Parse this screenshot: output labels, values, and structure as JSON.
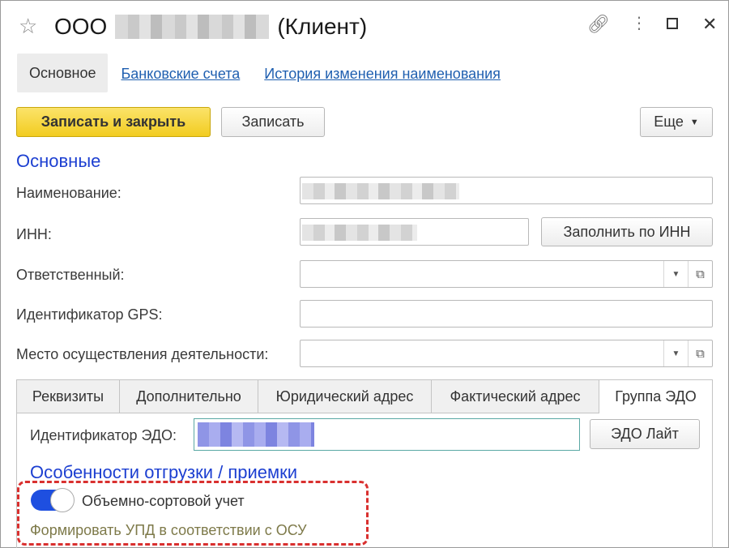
{
  "window": {
    "title_prefix": "ООО",
    "title_suffix": "(Клиент)"
  },
  "top_tabs": {
    "active": "Основное",
    "links": [
      "Банковские счета",
      "История изменения наименования"
    ]
  },
  "toolbar": {
    "save_close_label": "Записать и закрыть",
    "save_label": "Записать",
    "more_label": "Еще"
  },
  "section_main": {
    "title": "Основные",
    "name_label": "Наименование:",
    "inn_label": "ИНН:",
    "fill_inn_button": "Заполнить по ИНН",
    "responsible_label": "Ответственный:",
    "gps_label": "Идентификатор GPS:",
    "place_label": "Место осуществления деятельности:"
  },
  "bottom_tabs": [
    "Реквизиты",
    "Дополнительно",
    "Юридический адрес",
    "Фактический адрес",
    "Группа ЭДО"
  ],
  "edo": {
    "id_label": "Идентификатор ЭДО:",
    "lite_button": "ЭДО Лайт"
  },
  "shipping": {
    "title": "Особенности отгрузки / приемки",
    "toggle_label": "Объемно-сортовой учет",
    "toggle_on": true,
    "hint": "Формировать УПД в соответствии с ОСУ"
  },
  "colors": {
    "accent_yellow": "#f2cc20",
    "section_blue": "#1c3fd1",
    "link_blue": "#1f5fb0",
    "toggle_blue": "#1e4fe0",
    "highlight_red": "#d9302f"
  }
}
